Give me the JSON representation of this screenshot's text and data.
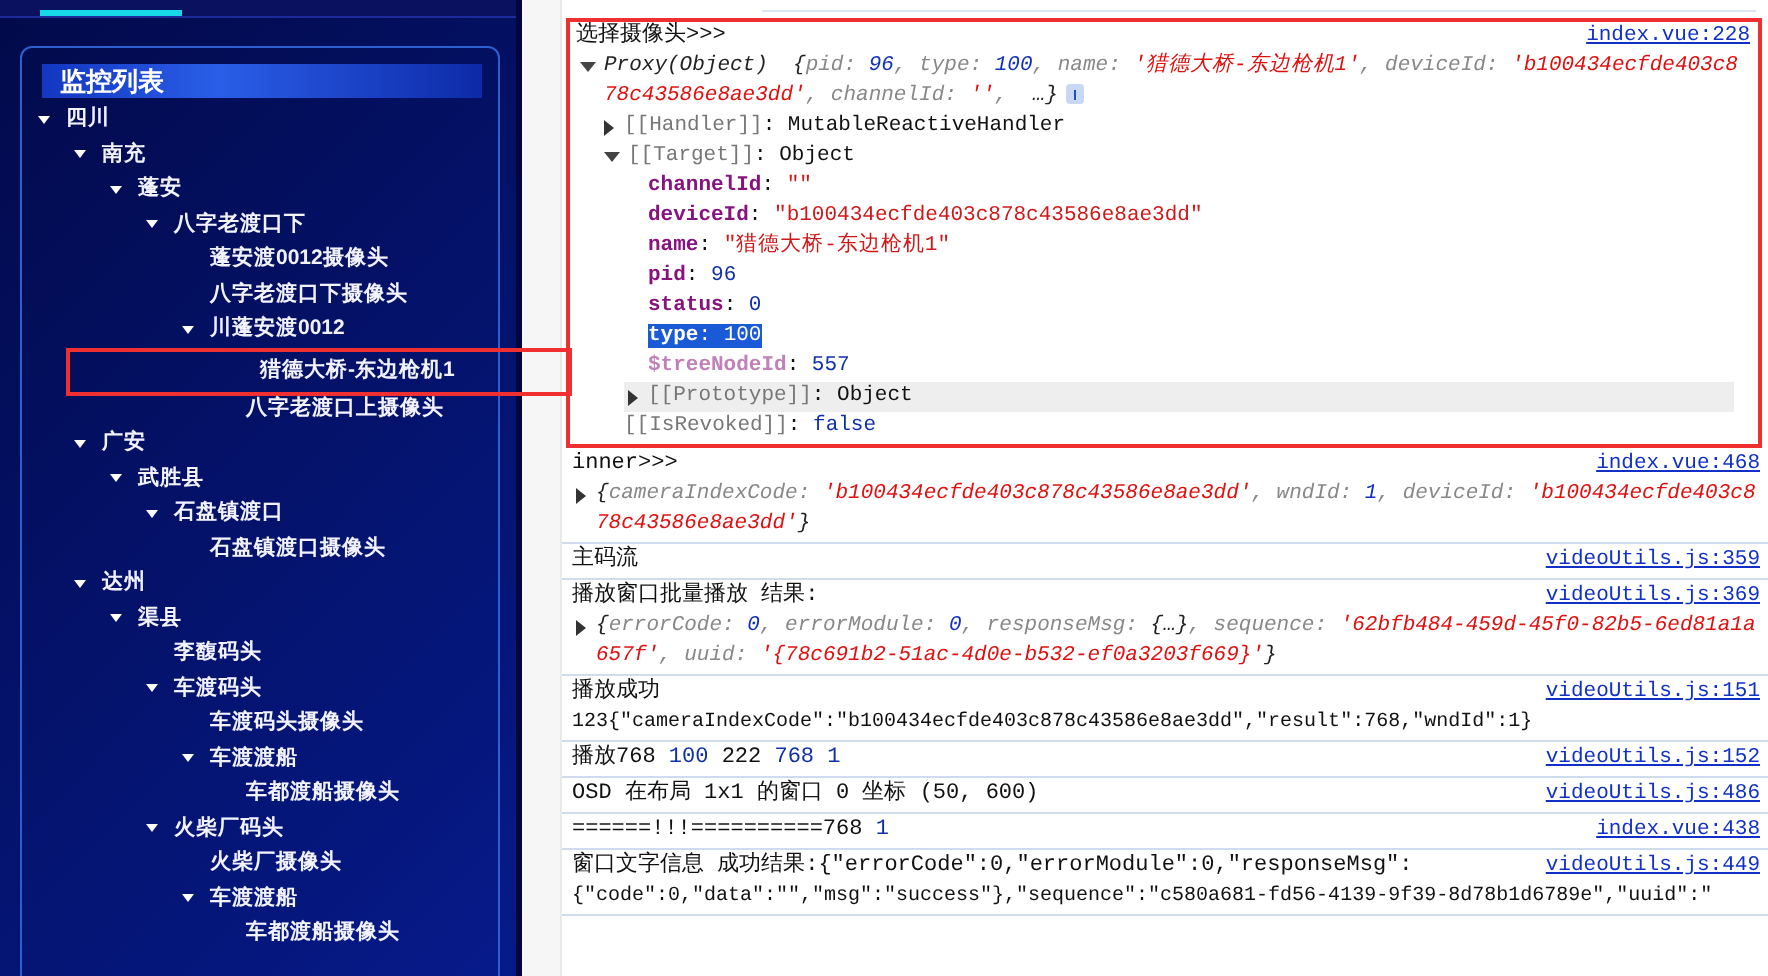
{
  "sidebar": {
    "title": "监控列表",
    "tree": [
      {
        "label": "四川",
        "expanded": true,
        "highlighted": false,
        "children": [
          {
            "label": "南充",
            "expanded": true,
            "highlighted": false,
            "children": [
              {
                "label": "蓬安",
                "expanded": true,
                "highlighted": false,
                "children": [
                  {
                    "label": "八字老渡口下",
                    "expanded": true,
                    "highlighted": false,
                    "children": [
                      {
                        "label": "蓬安渡0012摄像头",
                        "highlighted": false
                      },
                      {
                        "label": "八字老渡口下摄像头",
                        "highlighted": false
                      },
                      {
                        "label": "川蓬安渡0012",
                        "expanded": true,
                        "highlighted": false,
                        "children": [
                          {
                            "label": "猎德大桥-东边枪机1",
                            "highlighted": true
                          },
                          {
                            "label": "八字老渡口上摄像头",
                            "highlighted": false
                          }
                        ]
                      }
                    ]
                  }
                ]
              }
            ]
          },
          {
            "label": "广安",
            "expanded": true,
            "highlighted": false,
            "children": [
              {
                "label": "武胜县",
                "expanded": true,
                "highlighted": false,
                "children": [
                  {
                    "label": "石盘镇渡口",
                    "expanded": true,
                    "highlighted": false,
                    "children": [
                      {
                        "label": "石盘镇渡口摄像头",
                        "highlighted": false
                      }
                    ]
                  }
                ]
              }
            ]
          },
          {
            "label": "达州",
            "expanded": true,
            "highlighted": false,
            "children": [
              {
                "label": "渠县",
                "expanded": true,
                "highlighted": false,
                "children": [
                  {
                    "label": "李馥码头",
                    "highlighted": false
                  },
                  {
                    "label": "车渡码头",
                    "expanded": true,
                    "highlighted": false,
                    "children": [
                      {
                        "label": "车渡码头摄像头",
                        "highlighted": false
                      },
                      {
                        "label": "车渡渡船",
                        "expanded": true,
                        "highlighted": false,
                        "children": [
                          {
                            "label": "车都渡船摄像头",
                            "highlighted": false
                          }
                        ]
                      }
                    ]
                  },
                  {
                    "label": "火柴厂码头",
                    "expanded": true,
                    "highlighted": false,
                    "children": [
                      {
                        "label": "火柴厂摄像头",
                        "highlighted": false
                      },
                      {
                        "label": "车渡渡船",
                        "expanded": true,
                        "highlighted": false,
                        "children": [
                          {
                            "label": "车都渡船摄像头",
                            "highlighted": false
                          }
                        ]
                      }
                    ]
                  }
                ]
              }
            ]
          }
        ]
      }
    ]
  },
  "console": {
    "entries": [
      {
        "highlighted": true,
        "source": "index.vue:228",
        "message": [
          {
            "plain": "选择摄像头>>>"
          }
        ],
        "children": [
          {
            "kind": "preview",
            "expanded": true,
            "tokens": [
              {
                "ital": "Proxy(Object)  {"
              },
              {
                "pkey": "pid: "
              },
              {
                "pnum": "96"
              },
              {
                "pkey": ", type: "
              },
              {
                "pnum": "100"
              },
              {
                "pkey": ", name: "
              },
              {
                "pstr": "'猎德大桥-东边枪机1'"
              },
              {
                "pkey": ", deviceId: "
              },
              {
                "pstr": "'b100434ecfde403c878c43586e8ae3dd'"
              },
              {
                "pkey": ", channelId: "
              },
              {
                "pstr": "''"
              },
              {
                "pkey": ",  "
              },
              {
                "ital": "…}"
              }
            ],
            "children": [
              {
                "kind": "prop",
                "expanded": false,
                "tokens": [
                  {
                    "dim": "[[Handler]]"
                  },
                  {
                    "plain": ": MutableReactiveHandler"
                  }
                ]
              },
              {
                "kind": "prop",
                "expanded": true,
                "tokens": [
                  {
                    "dim": "[[Target]]"
                  },
                  {
                    "plain": ": Object"
                  }
                ],
                "children": [
                  {
                    "kind": "prop",
                    "selected": false,
                    "hovered": false,
                    "tokens": [
                      {
                        "key": "channelId"
                      },
                      {
                        "plain": ": "
                      },
                      {
                        "str": "\"\""
                      }
                    ]
                  },
                  {
                    "kind": "prop",
                    "selected": false,
                    "hovered": false,
                    "tokens": [
                      {
                        "key": "deviceId"
                      },
                      {
                        "plain": ": "
                      },
                      {
                        "str": "\"b100434ecfde403c878c43586e8ae3dd\""
                      }
                    ]
                  },
                  {
                    "kind": "prop",
                    "selected": false,
                    "hovered": false,
                    "tokens": [
                      {
                        "key": "name"
                      },
                      {
                        "plain": ": "
                      },
                      {
                        "str": "\"猎德大桥-东边枪机1\""
                      }
                    ]
                  },
                  {
                    "kind": "prop",
                    "selected": false,
                    "hovered": false,
                    "tokens": [
                      {
                        "key": "pid"
                      },
                      {
                        "plain": ": "
                      },
                      {
                        "num": "96"
                      }
                    ]
                  },
                  {
                    "kind": "prop",
                    "selected": false,
                    "hovered": false,
                    "tokens": [
                      {
                        "key": "status"
                      },
                      {
                        "plain": ": "
                      },
                      {
                        "num": "0"
                      }
                    ]
                  },
                  {
                    "kind": "prop",
                    "selected": true,
                    "hovered": false,
                    "tokens": [
                      {
                        "key": "type"
                      },
                      {
                        "plain": ": "
                      },
                      {
                        "num": "100"
                      }
                    ]
                  },
                  {
                    "kind": "prop",
                    "selected": false,
                    "hovered": false,
                    "tokens": [
                      {
                        "key2": "$treeNodeId"
                      },
                      {
                        "plain": ": "
                      },
                      {
                        "num": "557"
                      }
                    ]
                  },
                  {
                    "kind": "prop",
                    "expanded": false,
                    "selected": false,
                    "hovered": true,
                    "tokens": [
                      {
                        "dim": "[[Prototype]]"
                      },
                      {
                        "plain": ": Object"
                      }
                    ]
                  }
                ]
              },
              {
                "kind": "prop",
                "tokens": [
                  {
                    "dim": "[[IsRevoked]]"
                  },
                  {
                    "plain": ": "
                  },
                  {
                    "num": "false"
                  }
                ]
              }
            ]
          }
        ]
      },
      {
        "highlighted": false,
        "source": "index.vue:468",
        "message": [
          {
            "plain": "inner>>>"
          }
        ],
        "children": [
          {
            "kind": "prop",
            "expanded": false,
            "tokens": [
              {
                "ital": "{"
              },
              {
                "pkey": "cameraIndexCode: "
              },
              {
                "pstr": "'b100434ecfde403c878c43586e8ae3dd'"
              },
              {
                "pkey": ", wndId: "
              },
              {
                "pnum": "1"
              },
              {
                "pkey": ", deviceId: "
              },
              {
                "pstr": "'b100434ecfde403c878c43586e8ae3dd'"
              },
              {
                "ital": "}"
              }
            ]
          }
        ]
      },
      {
        "highlighted": false,
        "source": "videoUtils.js:359",
        "message": [
          {
            "plain": "主码流"
          }
        ]
      },
      {
        "highlighted": false,
        "source": "videoUtils.js:369",
        "message": [
          {
            "plain": "播放窗口批量播放 结果:"
          }
        ],
        "children": [
          {
            "kind": "prop",
            "expanded": false,
            "tokens": [
              {
                "ital": "{"
              },
              {
                "pkey": "errorCode: "
              },
              {
                "pnum": "0"
              },
              {
                "pkey": ", errorModule: "
              },
              {
                "pnum": "0"
              },
              {
                "pkey": ", responseMsg: "
              },
              {
                "ital": "{…}"
              },
              {
                "pkey": ", sequence: "
              },
              {
                "pstr": "'62bfb484-459d-45f0-82b5-6ed81a1a657f'"
              },
              {
                "pkey": ", uuid: "
              },
              {
                "pstr": "'{78c691b2-51ac-4d0e-b532-ef0a3203f669}'"
              },
              {
                "ital": "}"
              }
            ]
          }
        ]
      },
      {
        "highlighted": false,
        "source": "videoUtils.js:151",
        "message": [
          {
            "plain": "播放成功"
          }
        ],
        "detail": [
          {
            "plain": "123{\"cameraIndexCode\":\"b100434ecfde403c878c43586e8ae3dd\",\"result\":768,\"wndId\":1}"
          }
        ]
      },
      {
        "highlighted": false,
        "source": "videoUtils.js:152",
        "message": [
          {
            "plain": "播放768 "
          },
          {
            "num": "100"
          },
          {
            "plain": " 222 "
          },
          {
            "num": "768 1"
          }
        ]
      },
      {
        "highlighted": false,
        "source": "videoUtils.js:486",
        "message": [
          {
            "plain": "OSD 在布局 1x1 的窗口 0 坐标 (50, 600)"
          }
        ]
      },
      {
        "highlighted": false,
        "source": "index.vue:438",
        "message": [
          {
            "plain": "======!!!==========768 "
          },
          {
            "num": "1"
          }
        ]
      },
      {
        "highlighted": false,
        "source": "videoUtils.js:449",
        "message": [
          {
            "plain": "窗口文字信息 成功结果:{\"errorCode\":0,\"errorModule\":0,\"responseMsg\":"
          }
        ],
        "detail": [
          {
            "plain": "{\"code\":0,\"data\":\"\",\"msg\":\"success\"},\"sequence\":\"c580a681-fd56-4139-9f39-8d78b1d6789e\",\"uuid\":\""
          }
        ]
      }
    ]
  }
}
